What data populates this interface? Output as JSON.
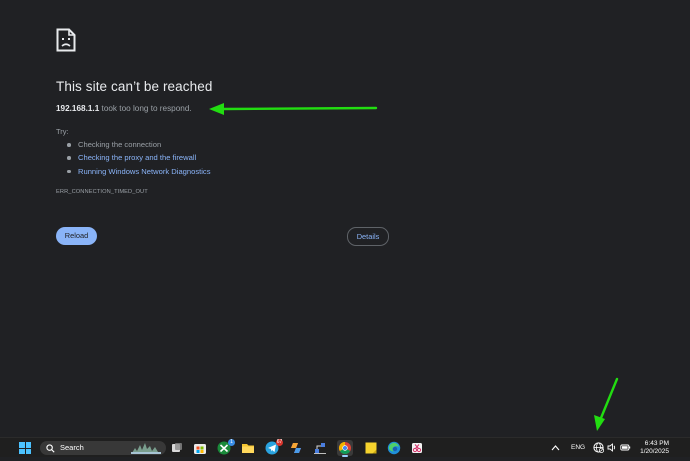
{
  "error_page": {
    "title": "This site can’t be reached",
    "host": "192.168.1.1",
    "desc_rest": " took too long to respond.",
    "try_label": "Try:",
    "suggestions": [
      {
        "text": "Checking the connection",
        "link": false
      },
      {
        "text": "Checking the proxy and the firewall",
        "link": true
      },
      {
        "text": "Running Windows Network Diagnostics",
        "link": true
      }
    ],
    "error_code": "ERR_CONNECTION_TIMED_OUT",
    "reload_label": "Reload",
    "details_label": "Details",
    "icon": "sad-page-icon"
  },
  "annotations": {
    "arrow_color": "#22dd11",
    "arrows": [
      "arrow-to-host-text",
      "arrow-to-network-tray-icon"
    ]
  },
  "taskbar": {
    "search_label": "Search",
    "apps": [
      {
        "name": "task-view-icon"
      },
      {
        "name": "microsoft-store-icon"
      },
      {
        "name": "xbox-icon",
        "badge": "1"
      },
      {
        "name": "file-explorer-icon"
      },
      {
        "name": "telegram-icon",
        "badge": "67"
      },
      {
        "name": "copilot-icon"
      },
      {
        "name": "network-app-icon"
      },
      {
        "name": "chrome-icon",
        "active": true
      },
      {
        "name": "sticky-notes-icon"
      },
      {
        "name": "edge-icon"
      },
      {
        "name": "snipping-tool-icon"
      }
    ],
    "tray": {
      "chevron": "chevron-up-icon",
      "language": "ENG",
      "network_icon": "network-disconnected-icon",
      "volume_icon": "volume-icon",
      "battery_icon": "battery-icon"
    },
    "time": "6:43 PM",
    "date": "1/20/2025"
  }
}
